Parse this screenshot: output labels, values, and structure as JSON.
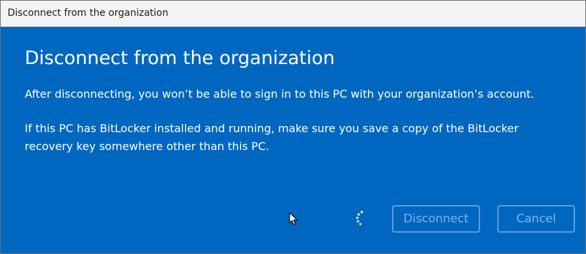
{
  "window": {
    "title": "Disconnect from the organization"
  },
  "dialog": {
    "heading": "Disconnect from the organization",
    "paragraph1": "After disconnecting, you won’t be able to sign in to this PC with your organization’s account.",
    "paragraph2": "If this PC has BitLocker installed and running, make sure you save a copy of the BitLocker recovery key somewhere other than this PC."
  },
  "buttons": {
    "disconnect_label": "Disconnect",
    "cancel_label": "Cancel"
  },
  "icons": {
    "spinner": "loading-spinner-icon",
    "cursor": "mouse-pointer-icon"
  },
  "colors": {
    "dialog_background": "#0067c0",
    "titlebar_background": "#f3f3f3",
    "text": "#ffffff",
    "disabled_button_text": "#7db3e6",
    "disabled_button_border": "#5e9edb"
  }
}
